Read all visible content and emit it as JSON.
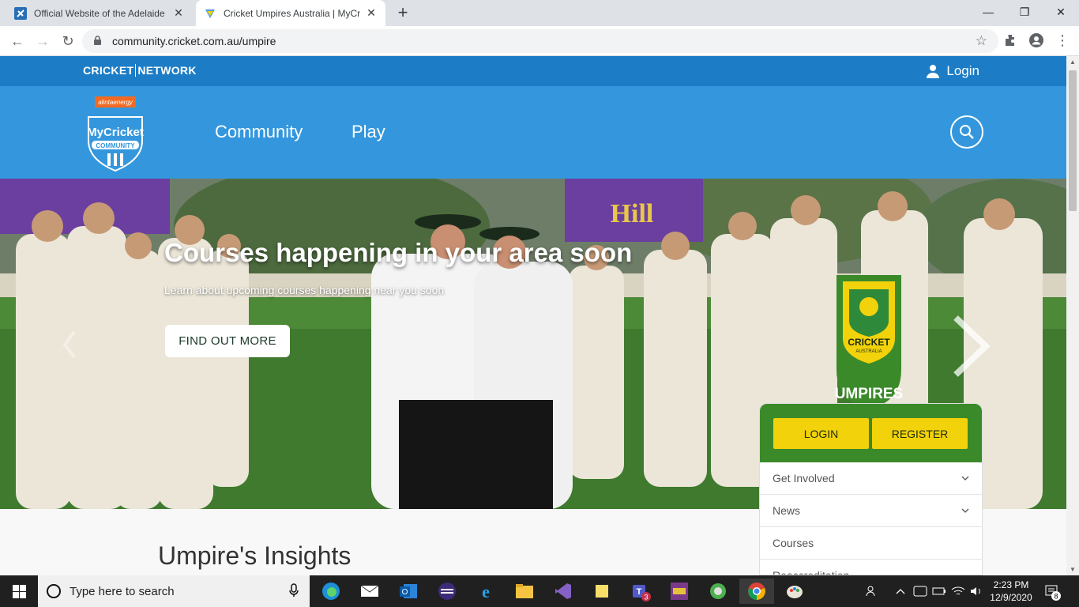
{
  "browser": {
    "tabs": [
      {
        "title": "Official Website of the Adelaide S",
        "active": false
      },
      {
        "title": "Cricket Umpires Australia | MyCri",
        "active": true
      }
    ],
    "new_tab_label": "+",
    "url": "community.cricket.com.au/umpire"
  },
  "site": {
    "network_logo_left": "CRICKET",
    "network_logo_right": "NETWORK",
    "login_label": "Login",
    "nav": [
      "Community",
      "Play"
    ],
    "logo": {
      "sponsor": "alintaenergy",
      "brand": "MyCricket",
      "sub": "COMMUNITY"
    }
  },
  "hero": {
    "title": "Courses happening in your area soon",
    "subtitle": "Learn about upcoming courses happening near you soon",
    "button_label": "FIND OUT MORE"
  },
  "umpires_badge": {
    "top": "CRICKET",
    "mid": "AUSTRALIA",
    "bottom": "UMPIRES"
  },
  "side_panel": {
    "login_label": "LOGIN",
    "register_label": "REGISTER",
    "items": [
      {
        "label": "Get Involved",
        "expandable": true
      },
      {
        "label": "News",
        "expandable": true
      },
      {
        "label": "Courses",
        "expandable": false
      },
      {
        "label": "Reaccreditation",
        "expandable": false
      }
    ]
  },
  "section_title": "Umpire's Insights",
  "taskbar": {
    "search_placeholder": "Type here to search",
    "time": "2:23 PM",
    "date": "12/9/2020",
    "teams_badge": "3",
    "notification_count": "8"
  },
  "colors": {
    "network_bar": "#1c7dc6",
    "header": "#3497dd",
    "umpire_green": "#3b8a2a",
    "umpire_yellow": "#f2d20a"
  }
}
